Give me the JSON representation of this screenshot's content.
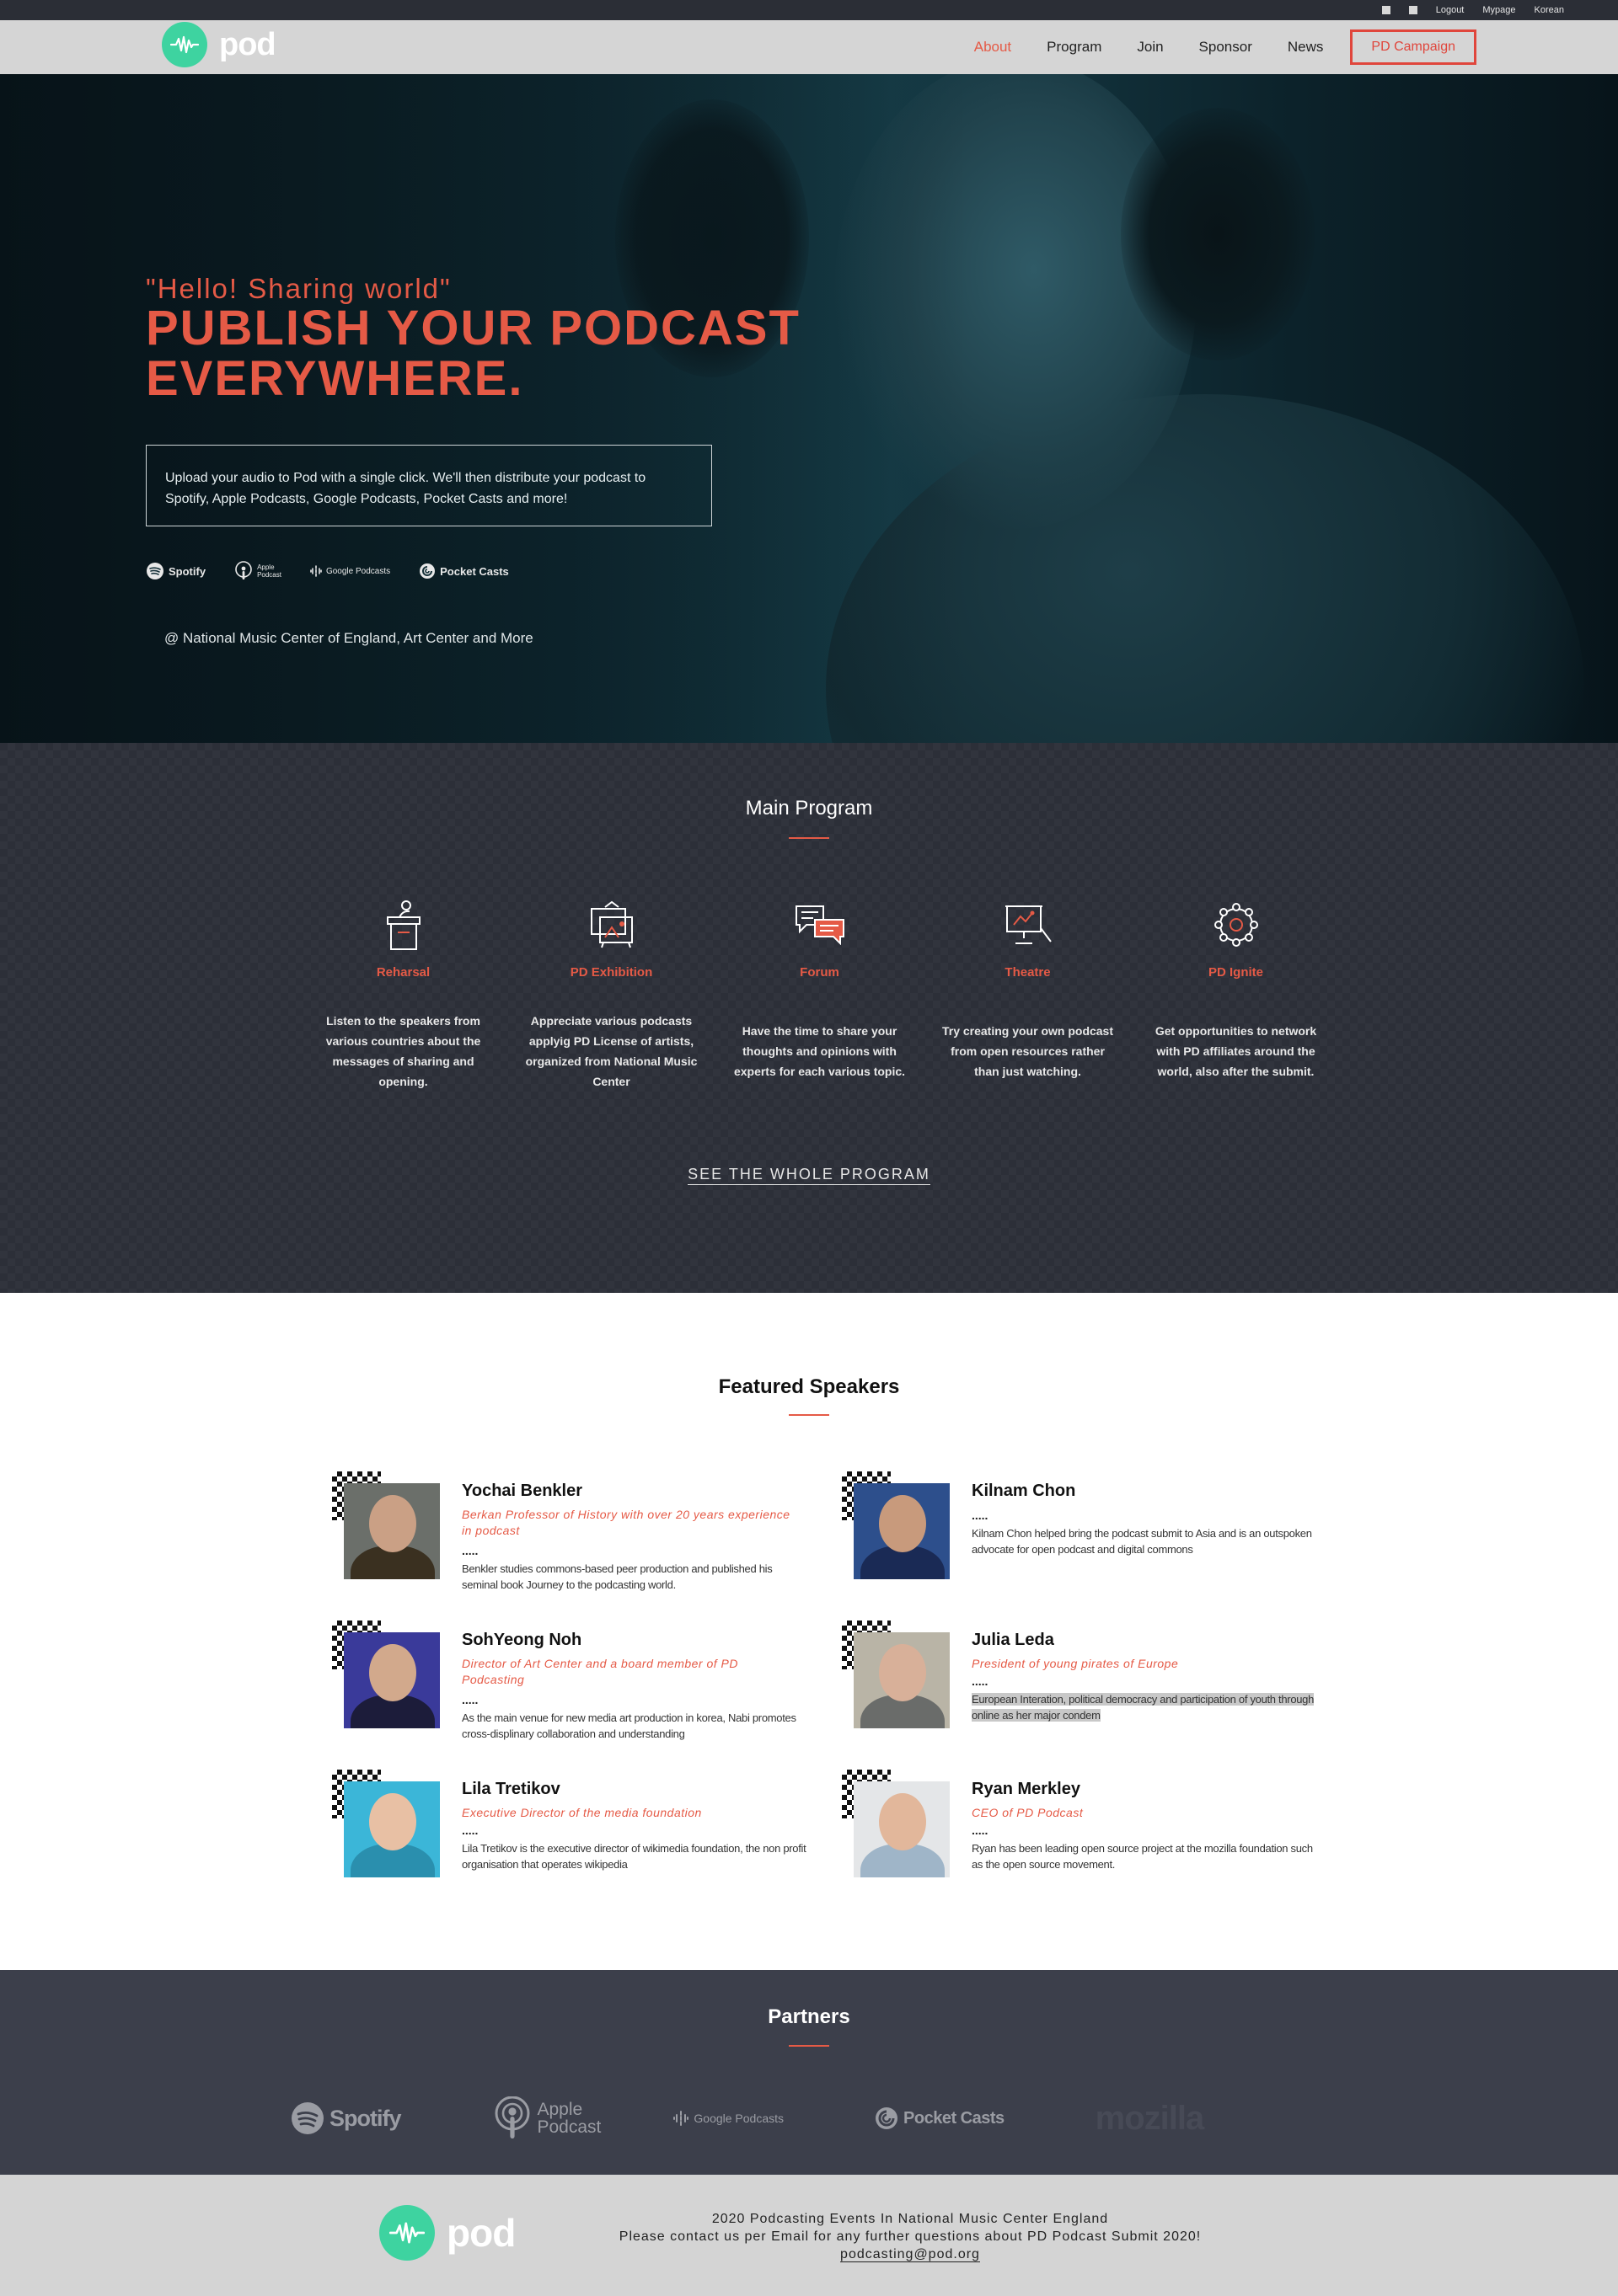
{
  "util": {
    "links": [
      "Logout",
      "Mypage",
      "Korean"
    ]
  },
  "brand": {
    "name": "pod"
  },
  "nav": {
    "items": [
      {
        "label": "About",
        "active": true
      },
      {
        "label": "Program",
        "active": false
      },
      {
        "label": "Join",
        "active": false
      },
      {
        "label": "Sponsor",
        "active": false
      },
      {
        "label": "News",
        "active": false
      }
    ],
    "cta": "PD Campaign"
  },
  "hero": {
    "tagline": "\"Hello! Sharing world\"",
    "headline_line1": "PUBLISH YOUR PODCAST",
    "headline_line2": "EVERYWHERE.",
    "description": "Upload your audio to Pod with a single click. We'll then distribute your podcast to Spotify, Apple Podcasts, Google Podcasts, Pocket Casts and more!",
    "platforms": {
      "spotify": "Spotify",
      "apple_line1": "Apple",
      "apple_line2": "Podcast",
      "google": "Google Podcasts",
      "pocketcasts": "Pocket Casts"
    },
    "location": "@ National Music Center of England, Art Center and More"
  },
  "program": {
    "title": "Main Program",
    "items": [
      {
        "name": "Reharsal",
        "icon": "podium-icon",
        "desc": "Listen to the speakers from various countries about the messages of sharing and opening."
      },
      {
        "name": "PD Exhibition",
        "icon": "exhibition-icon",
        "desc": "Appreciate various podcasts applyig PD License of artists, organized from National Music Center"
      },
      {
        "name": "Forum",
        "icon": "chat-bubbles-icon",
        "desc": "Have the time to share your thoughts and opinions with experts for each various topic."
      },
      {
        "name": "Theatre",
        "icon": "presentation-board-icon",
        "desc": "Try creating your own podcast from open resources rather than just watching."
      },
      {
        "name": "PD Ignite",
        "icon": "network-icon",
        "desc": "Get opportunities to network with PD affiliates around the world, also after the submit."
      }
    ],
    "see_all": "SEE THE WHOLE PROGRAM"
  },
  "speakers": {
    "title": "Featured Speakers",
    "items": [
      {
        "name": "Yochai Benkler",
        "role": "Berkan Professor of History with over 20 years experience in podcast",
        "dots": ".....",
        "bio": "Benkler studies commons-based peer production and published his seminal book Journey to the podcasting world."
      },
      {
        "name": "Kilnam Chon",
        "role": "",
        "dots": ".....",
        "bio": "Kilnam Chon helped bring the podcast submit to Asia and is an outspoken advocate for open podcast and digital commons"
      },
      {
        "name": "SohYeong Noh",
        "role": "Director of Art Center and a board member of PD Podcasting",
        "dots": ".....",
        "bio": "As the main venue for new media art production in korea, Nabi promotes cross-displinary collaboration and understanding"
      },
      {
        "name": "Julia Leda",
        "role": "President of young pirates of Europe",
        "dots": ".....",
        "bio": "European Interation, political democracy and participation of youth through online as her major condem"
      },
      {
        "name": "Lila Tretikov",
        "role": "Executive Director of the media foundation",
        "dots": ".....",
        "bio": "Lila Tretikov is the executive director of wikimedia foundation, the non profit organisation that operates wikipedia"
      },
      {
        "name": "Ryan Merkley",
        "role": "CEO of PD Podcast",
        "dots": ".....",
        "bio": "Ryan has been leading open source project at the mozilla foundation such as the open source movement."
      }
    ]
  },
  "partners": {
    "title": "Partners",
    "logos": {
      "spotify": "Spotify",
      "apple_line1": "Apple",
      "apple_line2": "Podcast",
      "google": "Google Podcasts",
      "pocketcasts": "Pocket Casts",
      "mozilla": "mozilla"
    }
  },
  "footer": {
    "line1": "2020 Podcasting Events In National Music Center England",
    "line2": "Please contact us per Email for any further questions about PD Podcast Submit 2020!",
    "email": "podcasting@pod.org"
  },
  "colors": {
    "accent": "#e55a46",
    "brand_green": "#3ed3a0",
    "dark_section": "#2c2f38",
    "partners_bg": "#3c3f4b",
    "nav_bg": "#d5d5d5"
  }
}
